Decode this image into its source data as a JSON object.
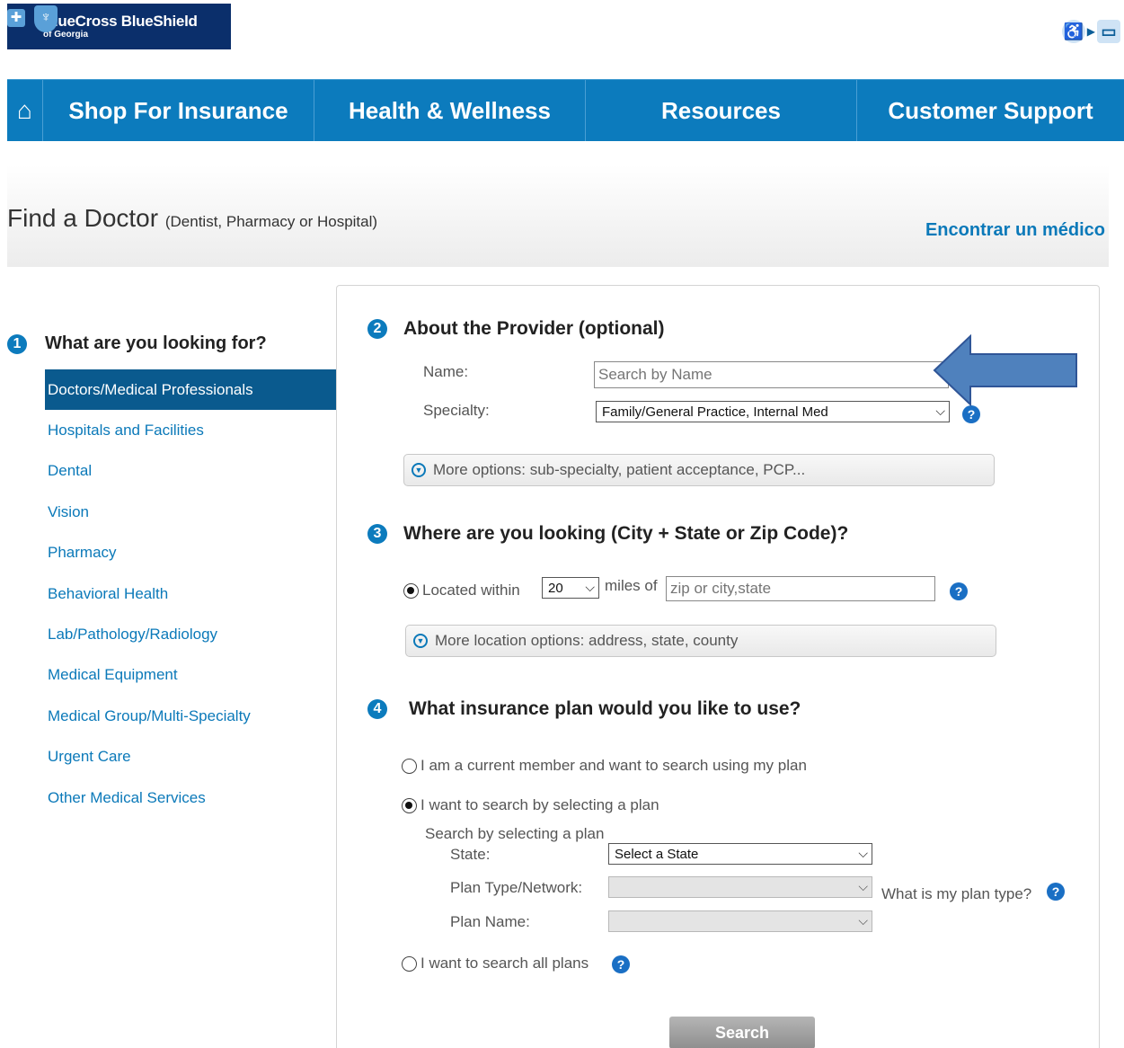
{
  "brand": {
    "line1": "BlueCross BlueShield",
    "line2": "of Georgia",
    "color": "#0b2f6b"
  },
  "accessibility": {
    "wheelchair_icon": "wheelchair-icon",
    "computer_icon": "computer-icon"
  },
  "nav": {
    "home_icon": "home-icon",
    "items": [
      {
        "label": "Shop For Insurance"
      },
      {
        "label": "Health & Wellness"
      },
      {
        "label": "Resources"
      },
      {
        "label": "Customer Support"
      }
    ],
    "color": "#0c7bbd"
  },
  "page": {
    "title": "Find a Doctor",
    "subtitle": "(Dentist, Pharmacy or Hospital)",
    "spanish_link": "Encontrar un médico"
  },
  "step1": {
    "num": "1",
    "heading": "What are you looking for?",
    "items": [
      {
        "label": "Doctors/Medical Professionals"
      },
      {
        "label": "Hospitals and Facilities"
      },
      {
        "label": "Dental"
      },
      {
        "label": "Vision"
      },
      {
        "label": "Pharmacy"
      },
      {
        "label": "Behavioral Health"
      },
      {
        "label": "Lab/Pathology/Radiology"
      },
      {
        "label": "Medical Equipment"
      },
      {
        "label": "Medical Group/Multi-Specialty"
      },
      {
        "label": "Urgent Care"
      },
      {
        "label": "Other Medical Services"
      }
    ],
    "selected_index": 0
  },
  "step2": {
    "num": "2",
    "heading": "About the Provider (optional)",
    "name_label": "Name:",
    "name_placeholder": "Search by Name",
    "specialty_label": "Specialty:",
    "specialty_value": "Family/General Practice, Internal Med",
    "more_options": "More options: sub-specialty, patient acceptance, PCP..."
  },
  "step3": {
    "num": "3",
    "heading": "Where are you looking (City + State or Zip Code)?",
    "located_label": "Located within",
    "miles_value": "20",
    "miles_label": "miles of",
    "location_placeholder": "zip or city,state",
    "more_options": "More location options: address, state, county"
  },
  "step4": {
    "num": "4",
    "heading": "What insurance plan would you like to use?",
    "option_member": "I am a current member and want to search using my plan",
    "option_select": "I want to search by selecting a plan",
    "sub_heading": "Search by selecting a plan",
    "state_label": "State:",
    "state_value": "Select a State",
    "plan_type_label": "Plan Type/Network:",
    "plan_type_help": "What is my plan type?",
    "plan_name_label": "Plan Name:",
    "option_all": "I want to search all plans",
    "selected_option": "select"
  },
  "search_button": "Search",
  "help_icon": "?"
}
